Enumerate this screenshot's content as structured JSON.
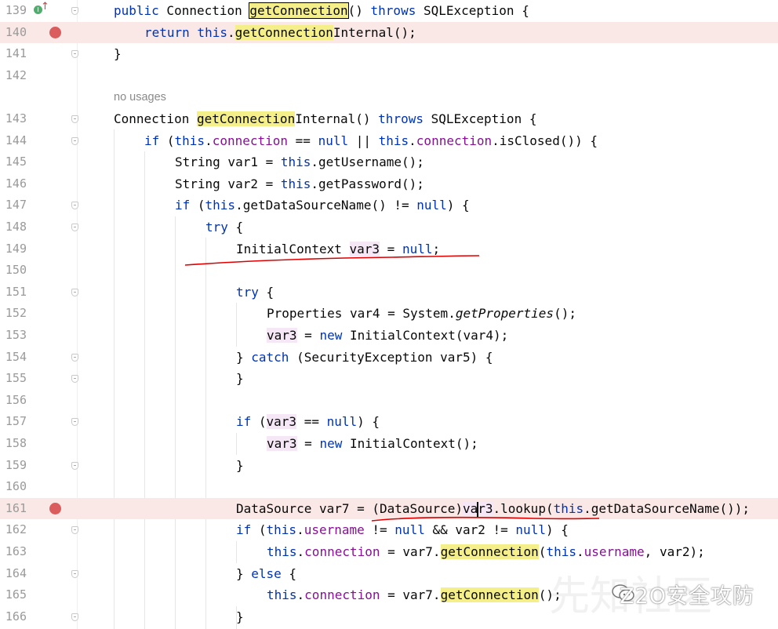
{
  "hint": "no usages",
  "line_numbers": [
    "139",
    "140",
    "141",
    "142",
    "143",
    "144",
    "145",
    "146",
    "147",
    "148",
    "149",
    "150",
    "151",
    "152",
    "153",
    "154",
    "155",
    "156",
    "157",
    "158",
    "159",
    "160",
    "161",
    "162",
    "163",
    "164",
    "165",
    "166"
  ],
  "impl_marker": "I",
  "watermark": "Z2O安全攻防",
  "watermark_bg": "先知社区",
  "colors": {
    "keyword": "#0033b3",
    "field": "#871094",
    "breakpoint": "#db5c5c",
    "breakpoint_line": "#fae8e6",
    "highlight": "#f5ef8a",
    "annotation_red": "#e00000"
  }
}
